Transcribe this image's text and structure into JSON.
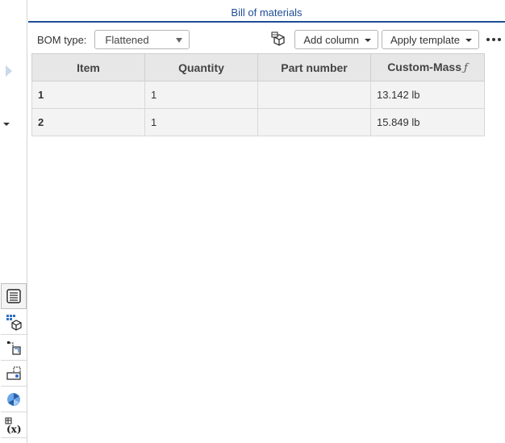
{
  "panel": {
    "title": "Bill of materials"
  },
  "toolbar": {
    "bom_type_label": "BOM type:",
    "bom_type_value": "Flattened",
    "add_column_label": "Add column",
    "apply_template_label": "Apply template"
  },
  "table": {
    "columns": [
      "Item",
      "Quantity",
      "Part number",
      "Custom-Mass"
    ],
    "formula_marker": "ƒ",
    "rows": [
      {
        "item": "1",
        "quantity": "1",
        "part_number": "",
        "custom_mass": "13.142 lb"
      },
      {
        "item": "2",
        "quantity": "1",
        "part_number": "",
        "custom_mass": "15.849 lb"
      }
    ]
  },
  "dock": {
    "items": [
      {
        "icon": "bom-list-icon",
        "active": true
      },
      {
        "icon": "appearance-grid-icon",
        "active": false
      },
      {
        "icon": "mate-connector-icon",
        "active": false
      },
      {
        "icon": "named-views-icon",
        "active": false
      },
      {
        "icon": "render-studio-icon",
        "active": false
      },
      {
        "icon": "variable-table-icon",
        "active": false
      }
    ]
  },
  "colors": {
    "accent": "#1f4e96",
    "header_bg": "#e7e7e7",
    "row_bg": "#f3f3f3"
  }
}
